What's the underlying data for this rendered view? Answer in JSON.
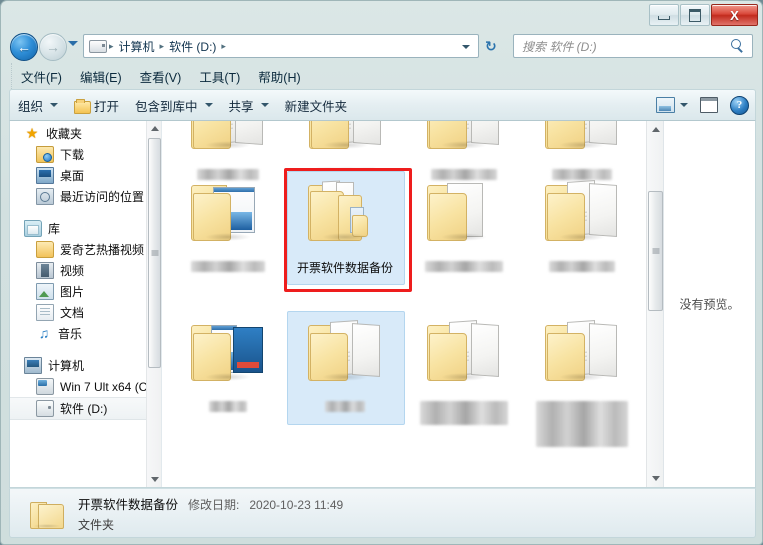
{
  "window": {
    "controls": {
      "minimize": "–",
      "maximize": "□",
      "close": "X"
    }
  },
  "address_bar": {
    "back_glyph": "←",
    "forward_glyph": "→",
    "drive_icon": "drive-icon",
    "breadcrumbs": [
      "计算机",
      "软件 (D:)"
    ],
    "separator": "▸",
    "refresh_glyph": "↻"
  },
  "search": {
    "placeholder": "搜索 软件 (D:)"
  },
  "menu": {
    "items": [
      {
        "label": "文件(F)"
      },
      {
        "label": "编辑(E)"
      },
      {
        "label": "查看(V)"
      },
      {
        "label": "工具(T)"
      },
      {
        "label": "帮助(H)"
      }
    ]
  },
  "toolbar": {
    "organize": "组织",
    "open": "打开",
    "include_library": "包含到库中",
    "share": "共享",
    "new_folder": "新建文件夹",
    "help_glyph": "?"
  },
  "sidebar": {
    "groups": [
      {
        "label": "收藏夹",
        "icon": "star-icon",
        "items": [
          {
            "label": "下载",
            "icon": "downloads-icon"
          },
          {
            "label": "桌面",
            "icon": "desktop-icon"
          },
          {
            "label": "最近访问的位置",
            "icon": "recent-places-icon"
          }
        ]
      },
      {
        "label": "库",
        "icon": "library-icon",
        "items": [
          {
            "label": "爱奇艺热播视频",
            "icon": "folder-icon"
          },
          {
            "label": "视频",
            "icon": "video-icon"
          },
          {
            "label": "图片",
            "icon": "pictures-icon"
          },
          {
            "label": "文档",
            "icon": "documents-icon"
          },
          {
            "label": "音乐",
            "icon": "music-icon"
          }
        ]
      },
      {
        "label": "计算机",
        "icon": "computer-icon",
        "items": [
          {
            "label": "Win 7 Ult x64 (C",
            "icon": "harddisk-icon",
            "selected": false
          },
          {
            "label": "软件 (D:)",
            "icon": "drive-icon",
            "selected": true
          }
        ]
      }
    ]
  },
  "files": {
    "items": [
      {
        "name_redacted": true,
        "redacted_width": 62,
        "art": "folder-docs",
        "selected": false
      },
      {
        "name_redacted": true,
        "redacted_width": 58,
        "art": "folder-docs",
        "selected": false
      },
      {
        "name_redacted": true,
        "redacted_width": 66,
        "art": "folder-docs",
        "selected": false
      },
      {
        "name_redacted": true,
        "redacted_width": 60,
        "art": "folder-docs",
        "selected": false
      },
      {
        "name_redacted": true,
        "redacted_width": 74,
        "art": "folder-screenshot",
        "selected": false
      },
      {
        "name": "开票软件数据备份",
        "art": "folder-multi",
        "selected": true,
        "highlighted": true
      },
      {
        "name_redacted": true,
        "redacted_width": 78,
        "art": "folder-docs",
        "selected": false
      },
      {
        "name_redacted": true,
        "redacted_width": 66,
        "art": "folder-docs",
        "selected": false
      },
      {
        "name_redacted": true,
        "redacted_width": 38,
        "art": "folder-screenshot",
        "selected": false
      },
      {
        "name_redacted": true,
        "redacted_width": 40,
        "art": "folder-docs",
        "selected": true
      },
      {
        "name_redacted": true,
        "redacted_width": 88,
        "art": "folder-docs",
        "selected": false
      },
      {
        "name_redacted": true,
        "redacted_width": 92,
        "art": "folder-docs",
        "selected": false
      }
    ]
  },
  "preview": {
    "message": "没有预览。"
  },
  "details": {
    "name": "开票软件数据备份",
    "modified_label": "修改日期:",
    "modified_value": "2020-10-23 11:49",
    "type": "文件夹"
  },
  "colors": {
    "selection_red": "#ee1d1d",
    "selection_blue": "#d8eaf9",
    "frame": "#cfdedd"
  }
}
